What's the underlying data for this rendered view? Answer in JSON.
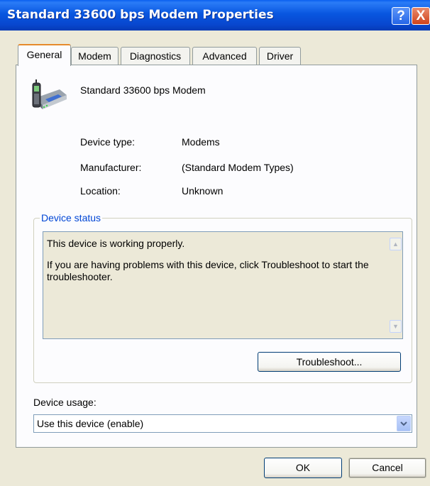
{
  "window": {
    "title": "Standard 33600 bps Modem Properties",
    "help_glyph": "?",
    "close_glyph": "X"
  },
  "tabs": [
    {
      "label": "General",
      "active": true
    },
    {
      "label": "Modem",
      "active": false
    },
    {
      "label": "Diagnostics",
      "active": false
    },
    {
      "label": "Advanced",
      "active": false
    },
    {
      "label": "Driver",
      "active": false
    }
  ],
  "device": {
    "name": "Standard 33600 bps Modem",
    "icon": "modem-icon",
    "properties": [
      {
        "label": "Device type:",
        "value": "Modems"
      },
      {
        "label": "Manufacturer:",
        "value": "(Standard Modem Types)"
      },
      {
        "label": "Location:",
        "value": "Unknown"
      }
    ]
  },
  "device_status": {
    "legend": "Device status",
    "line1": "This device is working properly.",
    "line2": "If you are having problems with this device, click Troubleshoot to start the troubleshooter.",
    "troubleshoot_label": "Troubleshoot..."
  },
  "device_usage": {
    "label": "Device usage:",
    "selected": "Use this device (enable)"
  },
  "footer": {
    "ok_label": "OK",
    "cancel_label": "Cancel"
  },
  "colors": {
    "title_bar": "#0a5ff0",
    "active_tab_accent": "#e68b2c",
    "group_legend": "#0046d5",
    "dialog_bg": "#ece9d8"
  }
}
